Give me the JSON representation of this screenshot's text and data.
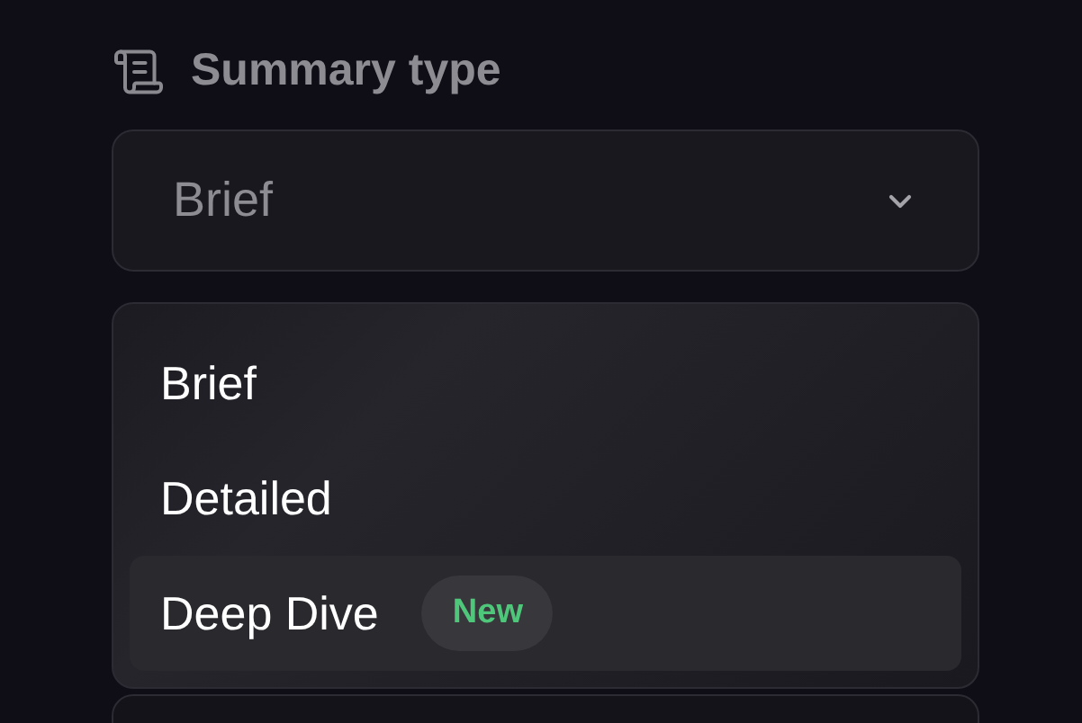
{
  "label": "Summary type",
  "select": {
    "value": "Brief",
    "expanded": true
  },
  "options": [
    {
      "label": "Brief",
      "highlighted": false
    },
    {
      "label": "Detailed",
      "highlighted": false
    },
    {
      "label": "Deep Dive",
      "highlighted": true,
      "badge": "New"
    }
  ]
}
